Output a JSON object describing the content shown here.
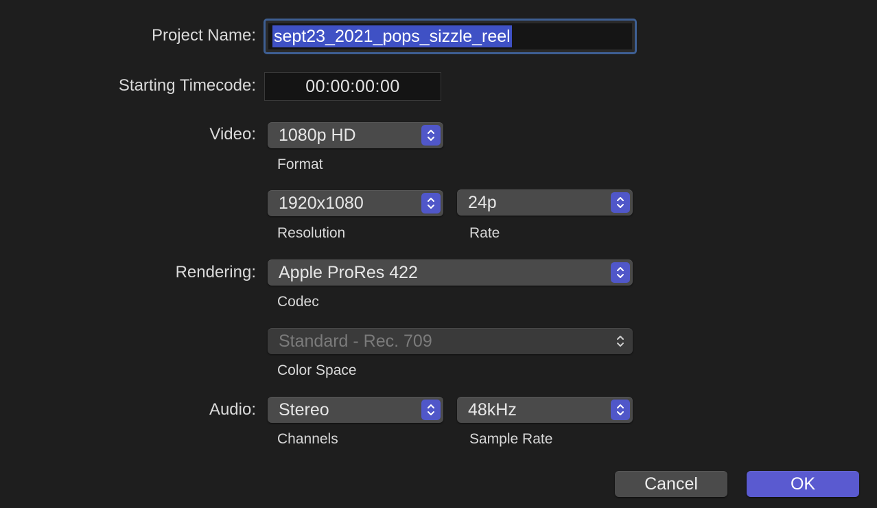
{
  "project_name": {
    "label": "Project Name:",
    "value": "sept23_2021_pops_sizzle_reel"
  },
  "starting_timecode": {
    "label": "Starting Timecode:",
    "value": "00:00:00:00"
  },
  "video": {
    "label": "Video:",
    "format": {
      "value": "1080p HD",
      "caption": "Format"
    },
    "resolution": {
      "value": "1920x1080",
      "caption": "Resolution"
    },
    "rate": {
      "value": "24p",
      "caption": "Rate"
    }
  },
  "rendering": {
    "label": "Rendering:",
    "codec": {
      "value": "Apple ProRes 422",
      "caption": "Codec"
    },
    "color_space": {
      "value": "Standard - Rec. 709",
      "caption": "Color Space",
      "enabled": false
    }
  },
  "audio": {
    "label": "Audio:",
    "channels": {
      "value": "Stereo",
      "caption": "Channels"
    },
    "sample_rate": {
      "value": "48kHz",
      "caption": "Sample Rate"
    }
  },
  "buttons": {
    "cancel": "Cancel",
    "ok": "OK"
  },
  "colors": {
    "background": "#1e1e1e",
    "accent": "#5057c9",
    "selection": "#3f51c5",
    "focus_ring": "#3e5f93"
  }
}
